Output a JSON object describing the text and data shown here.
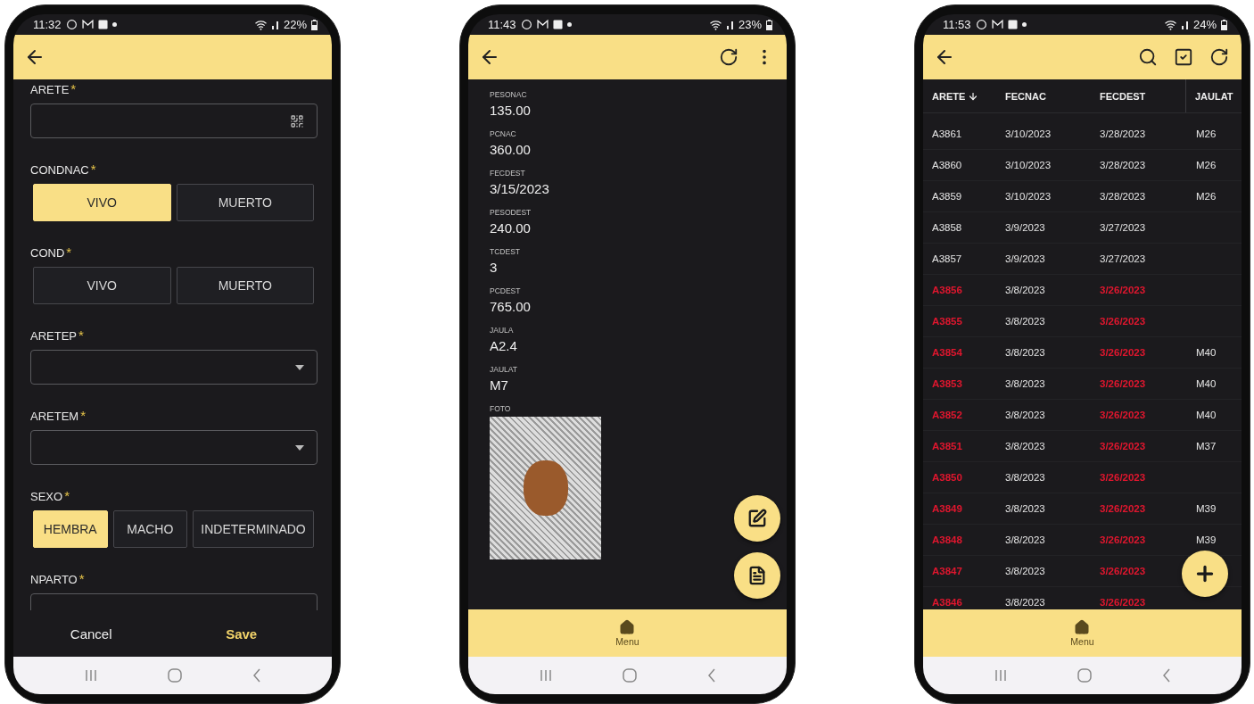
{
  "phones": [
    {
      "kind": "form",
      "status_bar": {
        "time": "11:32",
        "battery": "22%"
      },
      "fields": [
        {
          "kind": "text",
          "label": "ARETE",
          "mark": "*"
        },
        {
          "kind": "toggle",
          "label": "CONDNAC",
          "mark": "*",
          "options": [
            {
              "label": "VIVO",
              "selected": true
            },
            {
              "label": "MUERTO",
              "selected": false
            }
          ]
        },
        {
          "kind": "toggle",
          "label": "COND",
          "mark": "*",
          "options": [
            {
              "label": "VIVO",
              "selected": false
            },
            {
              "label": "MUERTO",
              "selected": false
            }
          ]
        },
        {
          "kind": "select",
          "label": "ARETEP",
          "mark": "*"
        },
        {
          "kind": "select",
          "label": "ARETEM",
          "mark": "*"
        },
        {
          "kind": "toggle",
          "label": "SEXO",
          "mark": "*",
          "options": [
            {
              "label": "HEMBRA",
              "selected": true
            },
            {
              "label": "MACHO",
              "selected": false
            },
            {
              "label": "INDETERMINADO",
              "selected": false
            }
          ]
        },
        {
          "kind": "number",
          "label": "NPARTO",
          "mark": "*"
        }
      ],
      "footer": {
        "cancel": "Cancel",
        "save": "Save"
      }
    },
    {
      "kind": "detail",
      "status_bar": {
        "time": "11:43",
        "battery": "23%"
      },
      "details": [
        {
          "label": "PESONAC",
          "value": "135.00"
        },
        {
          "label": "PCNAC",
          "value": "360.00"
        },
        {
          "label": "FECDEST",
          "value": "3/15/2023"
        },
        {
          "label": "PESODEST",
          "value": "240.00"
        },
        {
          "label": "TCDEST",
          "value": "3"
        },
        {
          "label": "PCDEST",
          "value": "765.00"
        },
        {
          "label": "JAULA",
          "value": "A2.4"
        },
        {
          "label": "JAULAT",
          "value": "M7"
        }
      ],
      "photo": {
        "label": "FOTO"
      },
      "bottom_nav": {
        "label": "Menu"
      }
    },
    {
      "kind": "table",
      "status_bar": {
        "time": "11:53",
        "battery": "24%"
      },
      "table": {
        "columns": [
          {
            "label": "ARETE",
            "sorted": true
          },
          {
            "label": "FECNAC",
            "sorted": false
          },
          {
            "label": "FECDEST",
            "sorted": false
          },
          {
            "label": "JAULAT",
            "sorted": false
          }
        ],
        "rows": [
          {
            "arete": "A3861",
            "fecnac": "3/10/2023",
            "fecdest": "3/28/2023",
            "jaulat": "M26",
            "overdue": false
          },
          {
            "arete": "A3860",
            "fecnac": "3/10/2023",
            "fecdest": "3/28/2023",
            "jaulat": "M26",
            "overdue": false
          },
          {
            "arete": "A3859",
            "fecnac": "3/10/2023",
            "fecdest": "3/28/2023",
            "jaulat": "M26",
            "overdue": false
          },
          {
            "arete": "A3858",
            "fecnac": "3/9/2023",
            "fecdest": "3/27/2023",
            "overdue": false
          },
          {
            "arete": "A3857",
            "fecnac": "3/9/2023",
            "fecdest": "3/27/2023",
            "overdue": false
          },
          {
            "arete": "A3856",
            "fecnac": "3/8/2023",
            "fecdest": "3/26/2023",
            "overdue": true
          },
          {
            "arete": "A3855",
            "fecnac": "3/8/2023",
            "fecdest": "3/26/2023",
            "overdue": true
          },
          {
            "arete": "A3854",
            "fecnac": "3/8/2023",
            "fecdest": "3/26/2023",
            "jaulat": "M40",
            "overdue": true
          },
          {
            "arete": "A3853",
            "fecnac": "3/8/2023",
            "fecdest": "3/26/2023",
            "jaulat": "M40",
            "overdue": true
          },
          {
            "arete": "A3852",
            "fecnac": "3/8/2023",
            "fecdest": "3/26/2023",
            "jaulat": "M40",
            "overdue": true
          },
          {
            "arete": "A3851",
            "fecnac": "3/8/2023",
            "fecdest": "3/26/2023",
            "jaulat": "M37",
            "overdue": true
          },
          {
            "arete": "A3850",
            "fecnac": "3/8/2023",
            "fecdest": "3/26/2023",
            "overdue": true
          },
          {
            "arete": "A3849",
            "fecnac": "3/8/2023",
            "fecdest": "3/26/2023",
            "jaulat": "M39",
            "overdue": true
          },
          {
            "arete": "A3848",
            "fecnac": "3/8/2023",
            "fecdest": "3/26/2023",
            "jaulat": "M39",
            "overdue": true
          },
          {
            "arete": "A3847",
            "fecnac": "3/8/2023",
            "fecdest": "3/26/2023",
            "overdue": true
          },
          {
            "arete": "A3846",
            "fecnac": "3/8/2023",
            "fecdest": "3/26/2023",
            "overdue": true
          }
        ]
      },
      "bottom_nav": {
        "label": "Menu"
      }
    }
  ]
}
